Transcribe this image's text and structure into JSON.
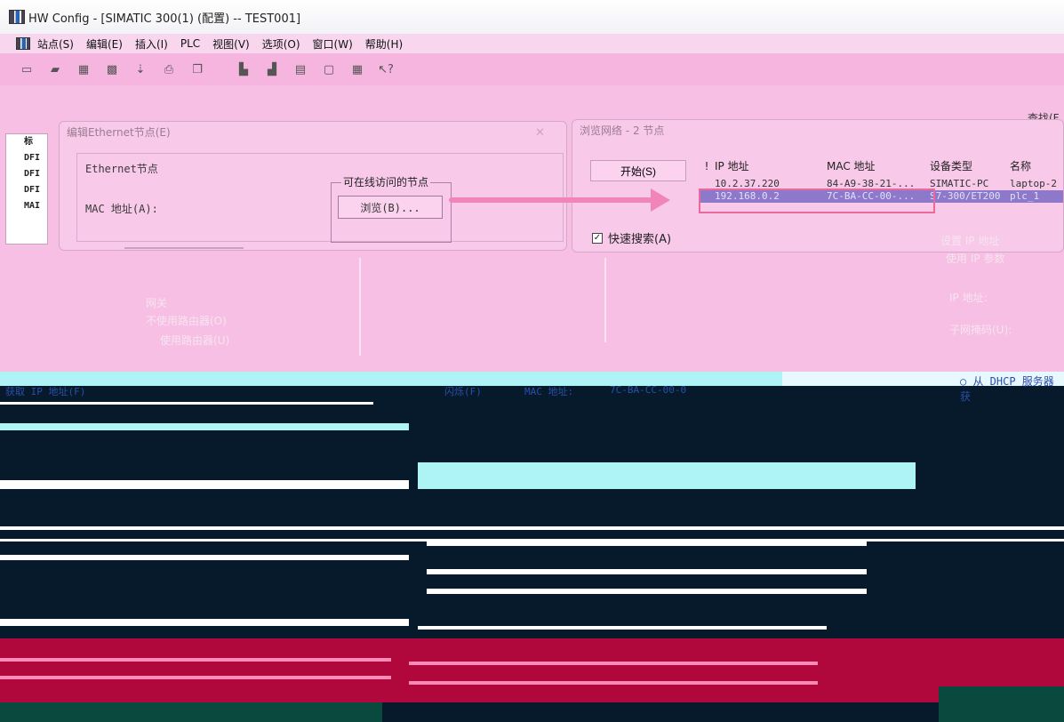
{
  "window": {
    "title": "HW Config - [SIMATIC 300(1) (配置) -- TEST001]"
  },
  "menu": [
    "站点(S)",
    "编辑(E)",
    "插入(I)",
    "PLC",
    "视图(V)",
    "选项(O)",
    "窗口(W)",
    "帮助(H)"
  ],
  "toolbar_icons": [
    "new-icon",
    "open-icon",
    "save-icon",
    "compile-icon",
    "download-icon",
    "print-icon",
    "copy-icon",
    "station-icon",
    "station2-icon",
    "catalog-icon",
    "window-icon",
    "network-icon",
    "help-icon"
  ],
  "left_strip": [
    "标",
    "DFI",
    "DFI",
    "DFI",
    "MAI"
  ],
  "ethernet_dialog": {
    "title": "编辑Ethernet节点(E)",
    "group_title": "Ethernet节点",
    "mac_label": "MAC 地址(A):",
    "accessible_title": "可在线访问的节点",
    "browse_button": "浏览(B)...",
    "close_glyph": "✕"
  },
  "browse_dialog": {
    "title": "浏览网络 - 2 节点",
    "start_button": "开始(S)",
    "columns": [
      "!",
      "IP 地址",
      "MAC 地址",
      "设备类型",
      "名称"
    ],
    "rows": [
      {
        "flag": "",
        "ip": "10.2.37.220",
        "mac": "84-A9-38-21-...",
        "type": "SIMATIC-PC",
        "name": "laptop-2"
      },
      {
        "flag": "",
        "ip": "192.168.0.2",
        "mac": "7C-BA-CC-00-...",
        "type": "S7-300/ET200",
        "name": "plc_1"
      }
    ],
    "quick_search_label": "快速搜索(A)"
  },
  "find_label": "查找(F",
  "ghost_text": {
    "ip_settings": "设置 IP 地址",
    "use_ip": "使用 IP 参数",
    "ip_address": "IP 地址:",
    "subnet_mask": "子网掩码(U):",
    "gateway": "网关",
    "no_router": "不使用路由器(O)",
    "use_router": "使用路由器(U)"
  },
  "lower_strip": {
    "left_label": "获取 IP 地址(F)",
    "flash_label": "闪烁(F)",
    "mac_label": "MAC 地址:",
    "mac_value": "7C-BA-CC-00-0",
    "dhcp_label": "○ 从 DHCP 服务器获"
  },
  "colors": {
    "accent": "#f086b8",
    "background": "#ffc8e6",
    "selection": "#8d78c9",
    "lower_dark": "#061a2c",
    "lower_red": "#b0083c"
  }
}
